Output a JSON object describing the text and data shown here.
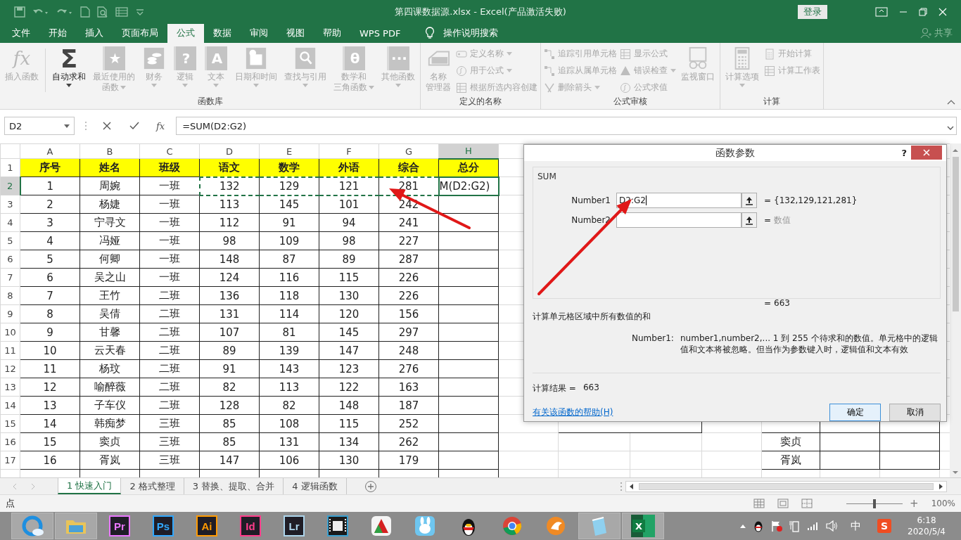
{
  "title_bar": {
    "title": "第四课数据源.xlsx  -  Excel(产品激活失败)",
    "login": "登录"
  },
  "menu_tabs": [
    {
      "label": "文件",
      "selected": false
    },
    {
      "label": "开始",
      "selected": false
    },
    {
      "label": "插入",
      "selected": false
    },
    {
      "label": "页面布局",
      "selected": false
    },
    {
      "label": "公式",
      "selected": true
    },
    {
      "label": "数据",
      "selected": false
    },
    {
      "label": "审阅",
      "selected": false
    },
    {
      "label": "视图",
      "selected": false
    },
    {
      "label": "帮助",
      "selected": false
    },
    {
      "label": "WPS PDF",
      "selected": false
    }
  ],
  "tell_me": "操作说明搜索",
  "share": "共享",
  "ribbon": [
    {
      "title": "函数库",
      "items": [
        {
          "kind": "fx",
          "glyph": "fx",
          "label": "插入函数",
          "disabled": true
        },
        {
          "kind": "sigma",
          "glyph": "Σ",
          "label": "自动求和",
          "disabled": false,
          "menu": true
        },
        {
          "kind": "book",
          "glyph": "★",
          "label": [
            "最近使用的",
            "函数"
          ],
          "disabled": true,
          "menu": true,
          "menu_inline": true
        },
        {
          "kind": "coins",
          "label": "财务",
          "disabled": true,
          "menu": true
        },
        {
          "kind": "book",
          "glyph": "?",
          "label": "逻辑",
          "disabled": true,
          "menu": true
        },
        {
          "kind": "book",
          "glyph": "A",
          "label": "文本",
          "disabled": true,
          "menu": true
        },
        {
          "kind": "calendar",
          "label": "日期和时间",
          "disabled": true,
          "menu": true
        },
        {
          "kind": "lens",
          "label": "查找与引用",
          "disabled": true,
          "menu": true
        },
        {
          "kind": "book",
          "glyph": "θ",
          "label": [
            "数学和",
            "三角函数"
          ],
          "disabled": true,
          "menu": true,
          "menu_inline": true
        },
        {
          "kind": "book",
          "glyph": "···",
          "label": "其他函数",
          "disabled": true,
          "menu": true
        }
      ]
    },
    {
      "title": "定义的名称",
      "items": [
        {
          "kind": "names",
          "label": [
            "名称",
            "管理器"
          ],
          "disabled": true
        },
        {
          "kind": "stack",
          "items": [
            {
              "kind": "tag",
              "label": "定义名称",
              "disabled": true,
              "menu": true
            },
            {
              "kind": "formula",
              "label": "用于公式",
              "disabled": true,
              "menu": true
            },
            {
              "kind": "grid",
              "label": "根据所选内容创建",
              "disabled": true
            }
          ]
        }
      ]
    },
    {
      "title": "公式审核",
      "items": [
        {
          "kind": "stack",
          "items": [
            {
              "kind": "trace",
              "label": "追踪引用单元格",
              "disabled": true
            },
            {
              "kind": "trace",
              "label": "追踪从属单元格",
              "disabled": true
            },
            {
              "kind": "remove",
              "label": "删除箭头",
              "disabled": true,
              "menu": true
            }
          ]
        },
        {
          "kind": "stack",
          "items": [
            {
              "kind": "grid",
              "label": "显示公式",
              "disabled": true
            },
            {
              "kind": "warn",
              "label": "错误检查",
              "disabled": true,
              "menu": true
            },
            {
              "kind": "formula",
              "label": "公式求值",
              "disabled": true
            }
          ]
        },
        {
          "kind": "watch",
          "label": "监视窗口",
          "disabled": true
        }
      ]
    },
    {
      "title": "计算",
      "items": [
        {
          "kind": "calc",
          "label": "计算选项",
          "disabled": true,
          "menu": true
        },
        {
          "kind": "stack",
          "items": [
            {
              "kind": "calc",
              "label": "开始计算",
              "disabled": true
            },
            {
              "kind": "grid",
              "label": "计算工作表",
              "disabled": true
            }
          ]
        }
      ]
    }
  ],
  "formula_bar": {
    "name_box": "D2",
    "insert_function": "fx",
    "formula": "=SUM(D2:G2)"
  },
  "sheet": {
    "columns": [
      "A",
      "B",
      "C",
      "D",
      "E",
      "F",
      "G",
      "H"
    ],
    "rows": [
      {
        "number": "1",
        "kind": "header",
        "cells": [
          "序号",
          "姓名",
          "班级",
          "语文",
          "数学",
          "外语",
          "综合",
          "总分"
        ]
      },
      {
        "number": "2",
        "cells": [
          "1",
          "周婉",
          "一班",
          {
            "text": "132",
            "in_range": true
          },
          {
            "text": "129",
            "in_range": true
          },
          {
            "text": "121",
            "in_range": true
          },
          {
            "text": "281",
            "in_range": true
          },
          {
            "text": "M(D2:G2)",
            "selected": true
          }
        ]
      },
      {
        "number": "3",
        "cells": [
          "2",
          "杨婕",
          "一班",
          "113",
          "145",
          "101",
          "242"
        ]
      },
      {
        "number": "4",
        "cells": [
          "3",
          "宁寻文",
          "一班",
          "112",
          "91",
          "94",
          "241"
        ]
      },
      {
        "number": "5",
        "cells": [
          "4",
          "冯娅",
          "一班",
          "98",
          "109",
          "98",
          "227"
        ]
      },
      {
        "number": "6",
        "cells": [
          "5",
          "何卿",
          "一班",
          "148",
          "87",
          "89",
          "287"
        ]
      },
      {
        "number": "7",
        "cells": [
          "6",
          "吴之山",
          "一班",
          "124",
          "116",
          "115",
          "226"
        ]
      },
      {
        "number": "8",
        "cells": [
          "7",
          "王竹",
          "二班",
          "136",
          "118",
          "130",
          "226"
        ]
      },
      {
        "number": "9",
        "cells": [
          "8",
          "吴倩",
          "二班",
          "131",
          "114",
          "120",
          "156"
        ]
      },
      {
        "number": "10",
        "cells": [
          "9",
          "甘馨",
          "二班",
          "107",
          "81",
          "145",
          "297"
        ]
      },
      {
        "number": "11",
        "cells": [
          "10",
          "云天春",
          "二班",
          "89",
          "139",
          "147",
          "248"
        ]
      },
      {
        "number": "12",
        "cells": [
          "11",
          "杨玟",
          "二班",
          "91",
          "143",
          "123",
          "276"
        ]
      },
      {
        "number": "13",
        "cells": [
          "12",
          "喻醉薇",
          "二班",
          "82",
          "113",
          "122",
          "163"
        ]
      },
      {
        "number": "14",
        "cells": [
          "13",
          "子车仪",
          "二班",
          "128",
          "82",
          "148",
          "187"
        ]
      },
      {
        "number": "15",
        "cells": [
          "14",
          "韩痴梦",
          "三班",
          "85",
          "108",
          "115",
          "252"
        ],
        "side_table": true,
        "side_box": true
      },
      {
        "number": "16",
        "cells": [
          "15",
          "窦贞",
          "三班",
          "85",
          "131",
          "134",
          "262"
        ],
        "side_table": true,
        "column_m": "窦贞"
      },
      {
        "number": "17",
        "cells": [
          "16",
          "胥岚",
          "三班",
          "147",
          "106",
          "130",
          "179"
        ],
        "side_table": true,
        "column_m": "胥岚"
      }
    ]
  },
  "dialog": {
    "title": "函数参数",
    "help": "?",
    "function": "SUM",
    "args": [
      {
        "label": "Number1",
        "value": "D2:G2",
        "eq": "=",
        "result": "{132,129,121,281}",
        "muted": false
      },
      {
        "label": "Number2",
        "eq": "=",
        "result": "数值",
        "muted": true
      }
    ],
    "total_eq": "=",
    "total": "663",
    "description": "计算单元格区域中所有数值的和",
    "arg_help_label": "Number1:",
    "arg_help": "number1,number2,...  1 到 255 个待求和的数值。单元格中的逻辑值和文本将被忽略。但当作为参数键入时，逻辑值和文本有效",
    "result_label": "计算结果 =",
    "result": "663",
    "help_link": "有关该函数的帮助(H)",
    "buttons": [
      {
        "label": "确定",
        "default": true
      },
      {
        "label": "取消",
        "default": false
      }
    ]
  },
  "sheet_tabs": [
    {
      "label": "1 快速入门",
      "selected": true
    },
    {
      "label": "2 格式整理",
      "selected": false
    },
    {
      "label": "3 替换、提取、合并",
      "selected": false
    },
    {
      "label": "4 逻辑函数",
      "selected": false
    }
  ],
  "status_bar": {
    "mode": "点",
    "zoom_in": "+",
    "zoom": {
      "level": 0.5
    },
    "zoom_text": "100%"
  },
  "taskbar": {
    "items": [
      {
        "kind": "browser",
        "open": true
      },
      {
        "kind": "folder",
        "open": true
      },
      {
        "kind": "tile",
        "label": "Pr",
        "color": "#ea77ff",
        "open": false
      },
      {
        "kind": "tile",
        "label": "Ps",
        "color": "#31a8ff",
        "open": false
      },
      {
        "kind": "tile",
        "label": "Ai",
        "color": "#ff9a00",
        "open": false
      },
      {
        "kind": "tile",
        "label": "Id",
        "color": "#ff3d8b",
        "open": false
      },
      {
        "kind": "tile",
        "label": "Lr",
        "color": "#add5ec",
        "open": false
      },
      {
        "kind": "film",
        "open": false
      },
      {
        "kind": "chart",
        "open": false
      },
      {
        "kind": "rabbit",
        "open": false
      },
      {
        "kind": "penguin",
        "open": false
      },
      {
        "kind": "chrome",
        "open": false
      },
      {
        "kind": "fox",
        "open": false
      },
      {
        "kind": "notepad",
        "open": true
      },
      {
        "kind": "excel",
        "label": "X",
        "open": true
      }
    ],
    "tray": {
      "ime": "中",
      "sogou": "S",
      "time": "6:18",
      "date": "2020/5/4"
    }
  }
}
